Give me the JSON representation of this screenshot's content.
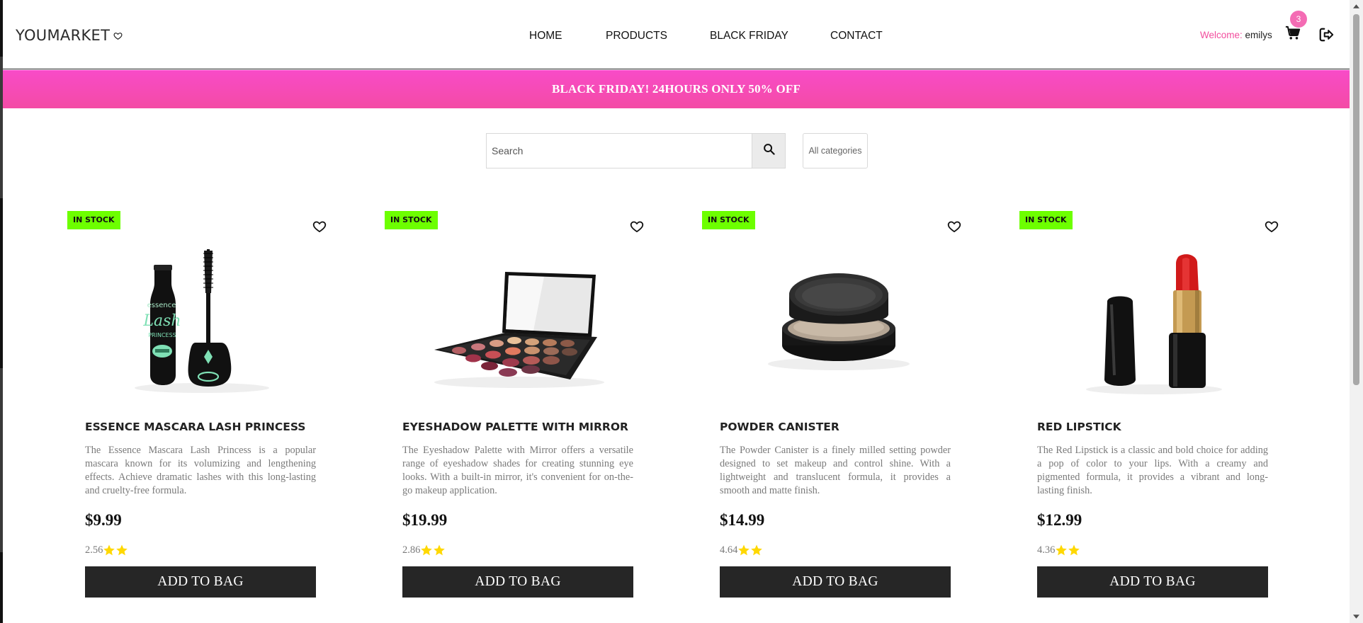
{
  "header": {
    "logo": "YOUMARKET",
    "logo_icon": "heart-outline-icon",
    "nav": [
      {
        "label": "HOME"
      },
      {
        "label": "PRODUCTS"
      },
      {
        "label": "BLACK FRIDAY"
      },
      {
        "label": "CONTACT"
      }
    ],
    "welcome_label": "Welcome:",
    "username": "emilys",
    "cart_count": "3",
    "cart_icon": "cart-icon",
    "logout_icon": "logout-icon"
  },
  "banner": {
    "text": "BLACK FRIDAY! 24HOURS ONLY 50% OFF"
  },
  "search": {
    "placeholder": "Search",
    "value": "",
    "button_icon": "search-icon",
    "category": "All categories"
  },
  "products": [
    {
      "badge": "IN STOCK",
      "title": "ESSENCE MASCARA LASH PRINCESS",
      "description": "The Essence Mascara Lash Princess is a popular mascara known for its volumizing and lengthening effects. Achieve dramatic lashes with this long-lasting and cruelty-free formula.",
      "price": "$9.99",
      "rating": "2.56",
      "stars": 2,
      "button": "ADD TO BAG",
      "image_icon": "mascara-image"
    },
    {
      "badge": "IN STOCK",
      "title": "EYESHADOW PALETTE WITH MIRROR",
      "description": "The Eyeshadow Palette with Mirror offers a versatile range of eyeshadow shades for creating stunning eye looks. With a built-in mirror, it's convenient for on-the-go makeup application.",
      "price": "$19.99",
      "rating": "2.86",
      "stars": 2,
      "button": "ADD TO BAG",
      "image_icon": "eyeshadow-palette-image"
    },
    {
      "badge": "IN STOCK",
      "title": "POWDER CANISTER",
      "description": "The Powder Canister is a finely milled setting powder designed to set makeup and control shine. With a lightweight and translucent formula, it provides a smooth and matte finish.",
      "price": "$14.99",
      "rating": "4.64",
      "stars": 2,
      "button": "ADD TO BAG",
      "image_icon": "powder-canister-image"
    },
    {
      "badge": "IN STOCK",
      "title": "RED LIPSTICK",
      "description": "The Red Lipstick is a classic and bold choice for adding a pop of color to your lips. With a creamy and pigmented formula, it provides a vibrant and long-lasting finish.",
      "price": "$12.99",
      "rating": "4.36",
      "stars": 2,
      "button": "ADD TO BAG",
      "image_icon": "lipstick-image"
    }
  ],
  "colors": {
    "accent_pink": "#f24d9d",
    "banner_top": "#f84bc8",
    "banner_bottom": "#f44ba5",
    "badge_green": "#6dff00",
    "button_dark": "#262626",
    "star_yellow": "#ffd800"
  }
}
